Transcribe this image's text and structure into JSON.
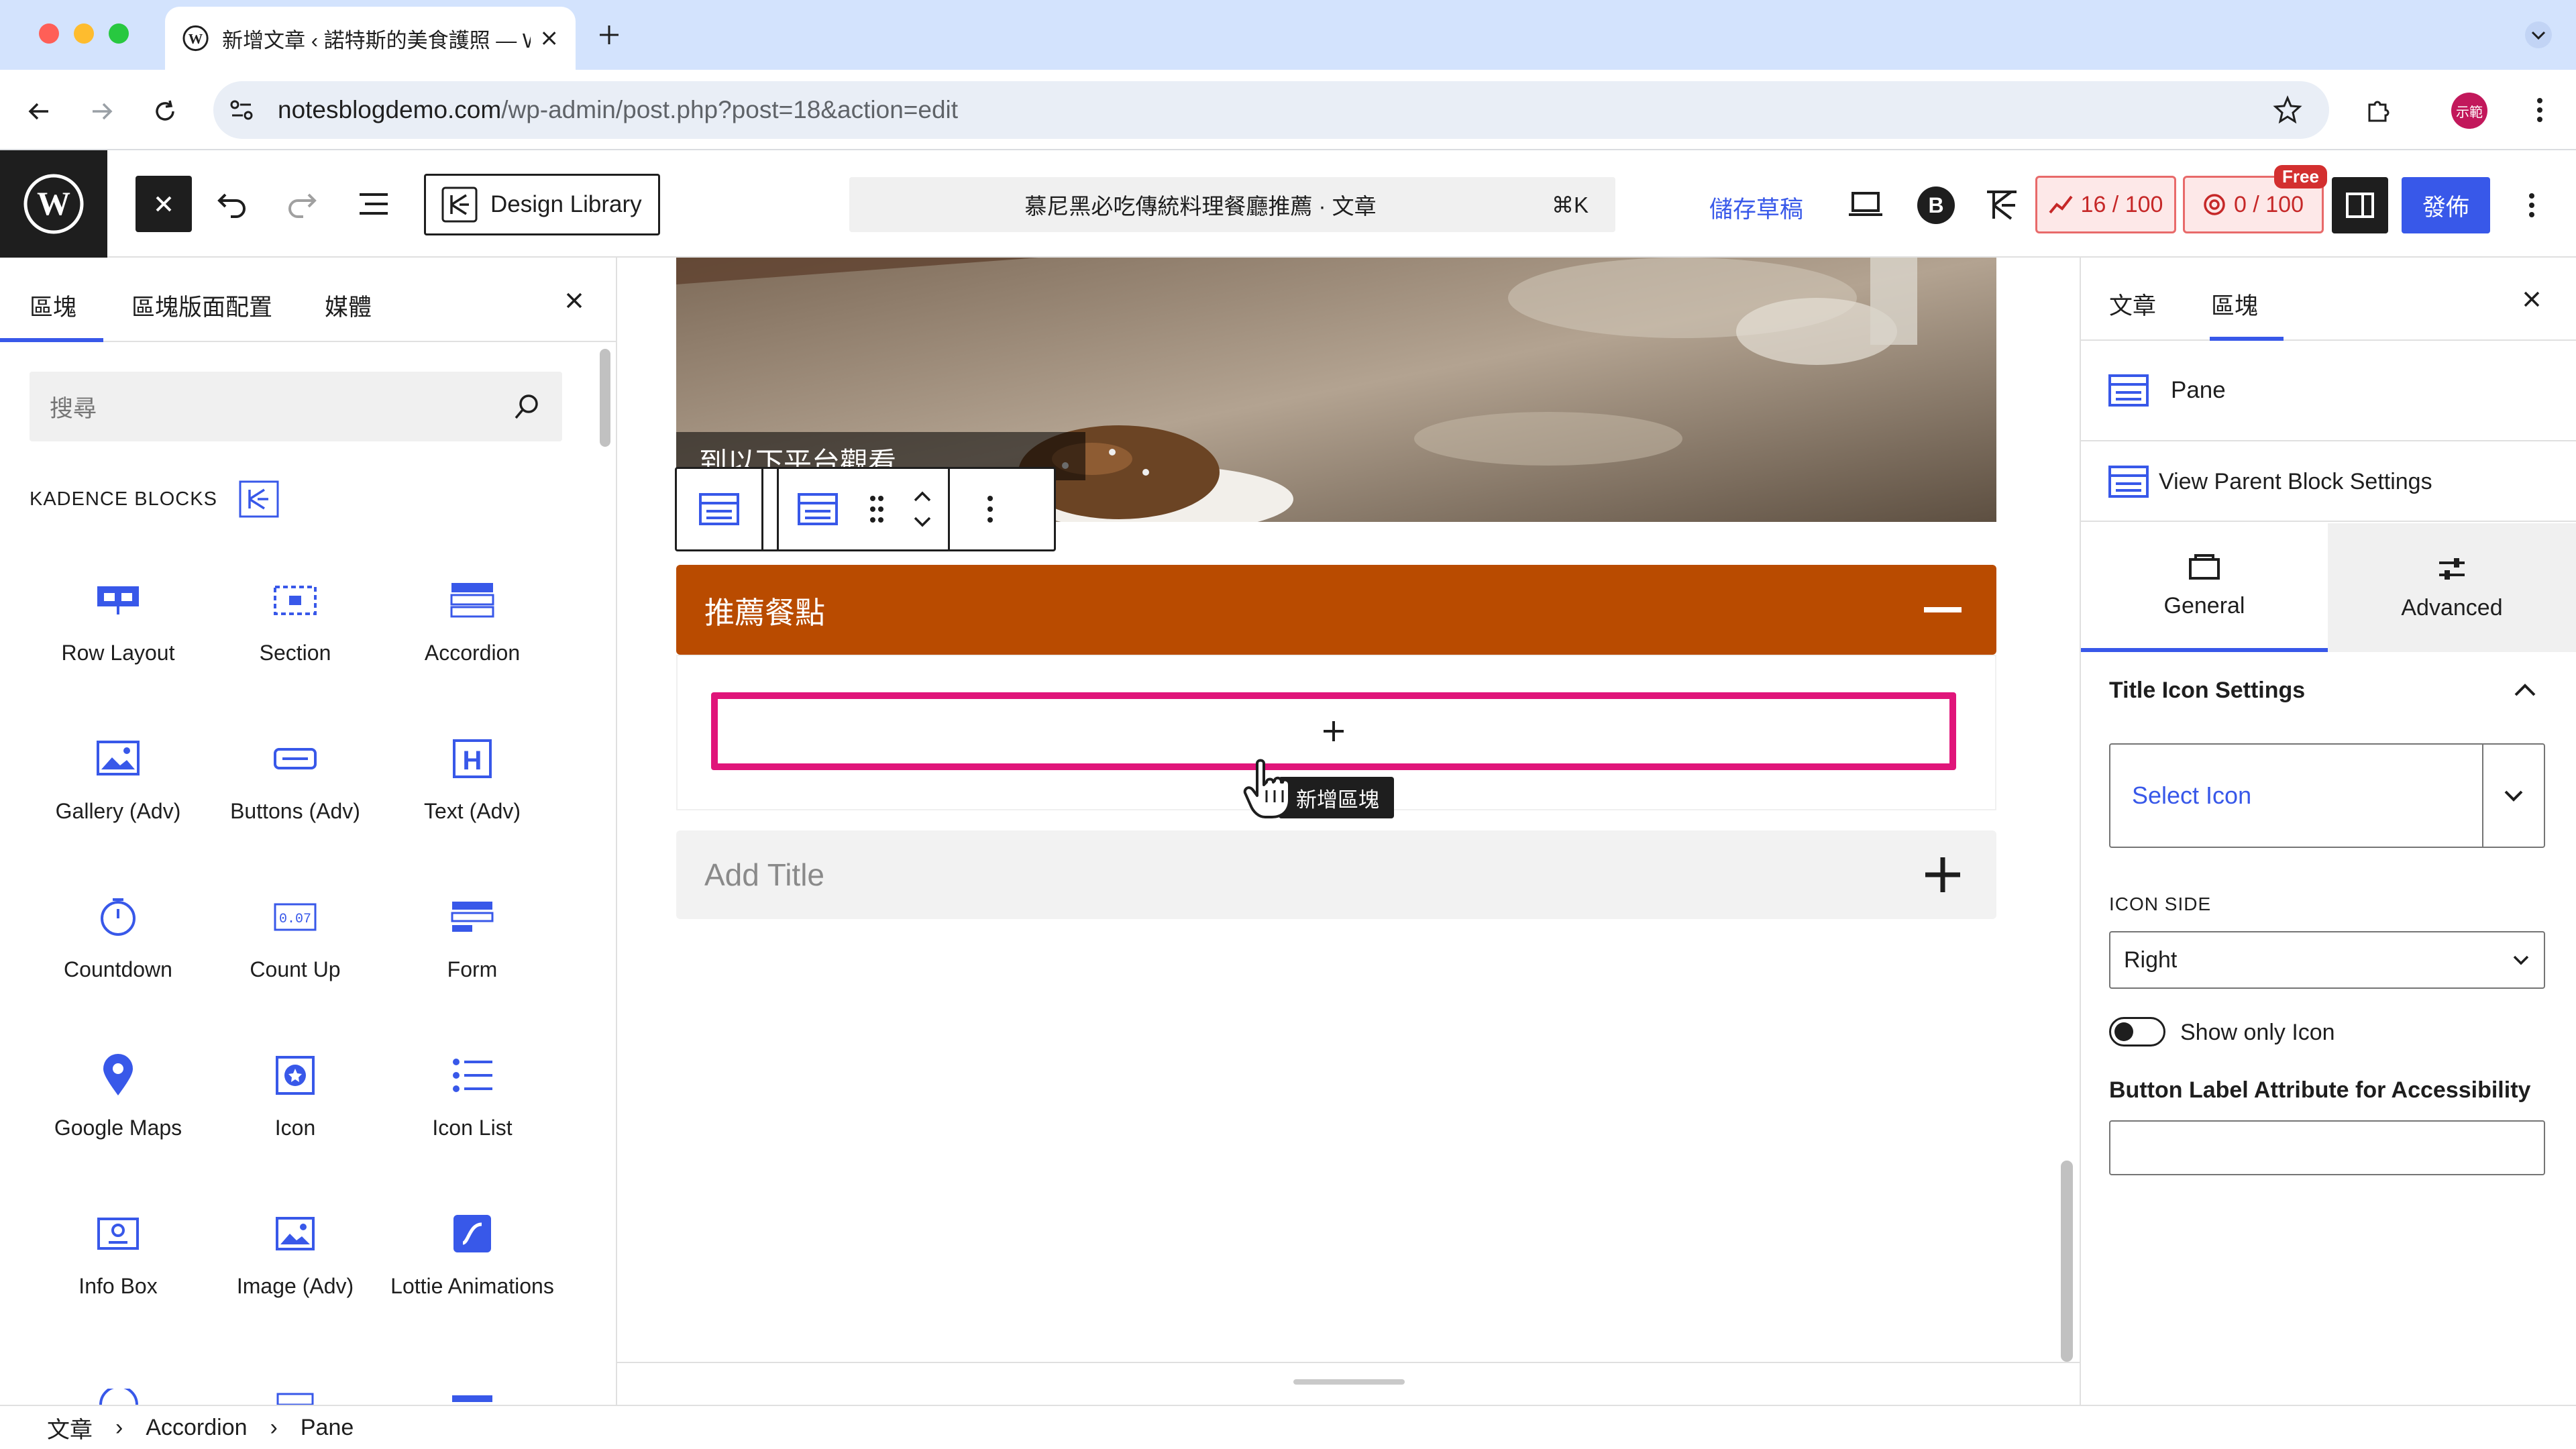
{
  "browser": {
    "tab_title": "新增文章 ‹ 諾特斯的美食護照 — WordPress",
    "url_domain": "notesblogdemo.com",
    "url_path": "/wp-admin/post.php?post=18&action=edit",
    "profile_label": "示範"
  },
  "header": {
    "design_library": "Design Library",
    "command_title": "慕尼黑必吃傳統料理餐廳推薦 · 文章",
    "command_shortcut": "⌘K",
    "save_draft": "儲存草稿",
    "seo_score": "16 / 100",
    "readability_score": "0 / 100",
    "free_badge": "Free",
    "publish": "發佈"
  },
  "inserter": {
    "tabs": [
      "區塊",
      "區塊版面配置",
      "媒體"
    ],
    "search_placeholder": "搜尋",
    "category_label": "KADENCE BLOCKS",
    "blocks": [
      {
        "label": "Row Layout",
        "icon": "row-layout-icon"
      },
      {
        "label": "Section",
        "icon": "section-icon"
      },
      {
        "label": "Accordion",
        "icon": "accordion-icon"
      },
      {
        "label": "Gallery (Adv)",
        "icon": "gallery-icon"
      },
      {
        "label": "Buttons (Adv)",
        "icon": "buttons-icon"
      },
      {
        "label": "Text (Adv)",
        "icon": "text-adv-icon"
      },
      {
        "label": "Countdown",
        "icon": "countdown-icon"
      },
      {
        "label": "Count Up",
        "icon": "count-up-icon"
      },
      {
        "label": "Form",
        "icon": "form-icon"
      },
      {
        "label": "Google Maps",
        "icon": "map-pin-icon"
      },
      {
        "label": "Icon",
        "icon": "star-icon"
      },
      {
        "label": "Icon List",
        "icon": "list-icon"
      },
      {
        "label": "Info Box",
        "icon": "info-box-icon"
      },
      {
        "label": "Image (Adv)",
        "icon": "image-icon"
      },
      {
        "label": "Lottie Animations",
        "icon": "lottie-icon"
      }
    ]
  },
  "canvas": {
    "image_caption": "到以下平台觀看",
    "accordion_title": "推薦餐點",
    "appender_tooltip": "新增區塊",
    "add_title_placeholder": "Add Title"
  },
  "settings": {
    "tabs": [
      "文章",
      "區塊"
    ],
    "block_name": "Pane",
    "view_parent": "View Parent Block Settings",
    "segments": [
      "General",
      "Advanced"
    ],
    "panel_title": "Title Icon Settings",
    "select_icon_placeholder": "Select Icon",
    "icon_side_label": "ICON SIDE",
    "icon_side_value": "Right",
    "show_only_icon": "Show only Icon",
    "button_label_attr": "Button Label Attribute for Accessibility",
    "show_only_icon_on": false
  },
  "breadcrumb": [
    "文章",
    "Accordion",
    "Pane"
  ],
  "colors": {
    "accent": "#3858e9",
    "accordion_bar": "#b94b00",
    "appender_border": "#e0157a",
    "seo_red": "#c62828"
  }
}
